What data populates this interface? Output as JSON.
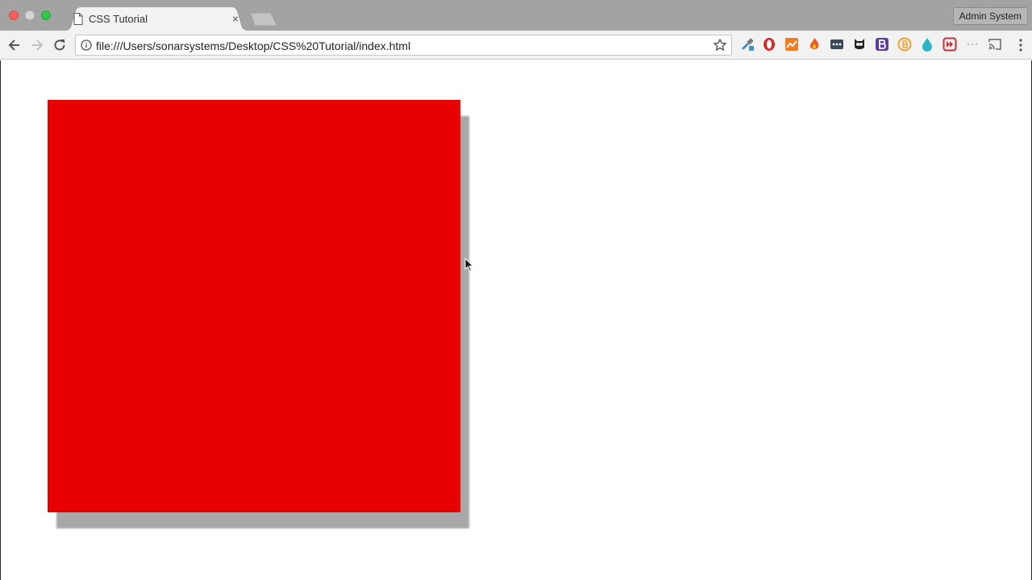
{
  "window": {
    "tab_title": "CSS Tutorial",
    "tab_close": "×",
    "profile_name": "Admin System"
  },
  "toolbar": {
    "url": "file:///Users/sonarsystems/Desktop/CSS%20Tutorial/index.html"
  },
  "extensions": [
    {
      "name": "eyedropper-extension-icon",
      "color": "#4a90c8"
    },
    {
      "name": "opera-extension-icon",
      "color": "#d42a2a"
    },
    {
      "name": "chart-extension-icon",
      "color": "#f07d22"
    },
    {
      "name": "flame-extension-icon",
      "color": "#f05a22"
    },
    {
      "name": "dots-extension-icon",
      "color": "#3b4a5a"
    },
    {
      "name": "owl-extension-icon",
      "color": "#222222"
    },
    {
      "name": "bootstrap-extension-icon",
      "color": "#5b3fa0"
    },
    {
      "name": "bitcoin-extension-icon",
      "color": "#f0a030"
    },
    {
      "name": "droplet-extension-icon",
      "color": "#2ab5c8"
    },
    {
      "name": "forward-extension-icon",
      "color": "#c0303a"
    }
  ],
  "page": {
    "box_color": "#e60000",
    "shadow_color": "#a8a8a8"
  }
}
